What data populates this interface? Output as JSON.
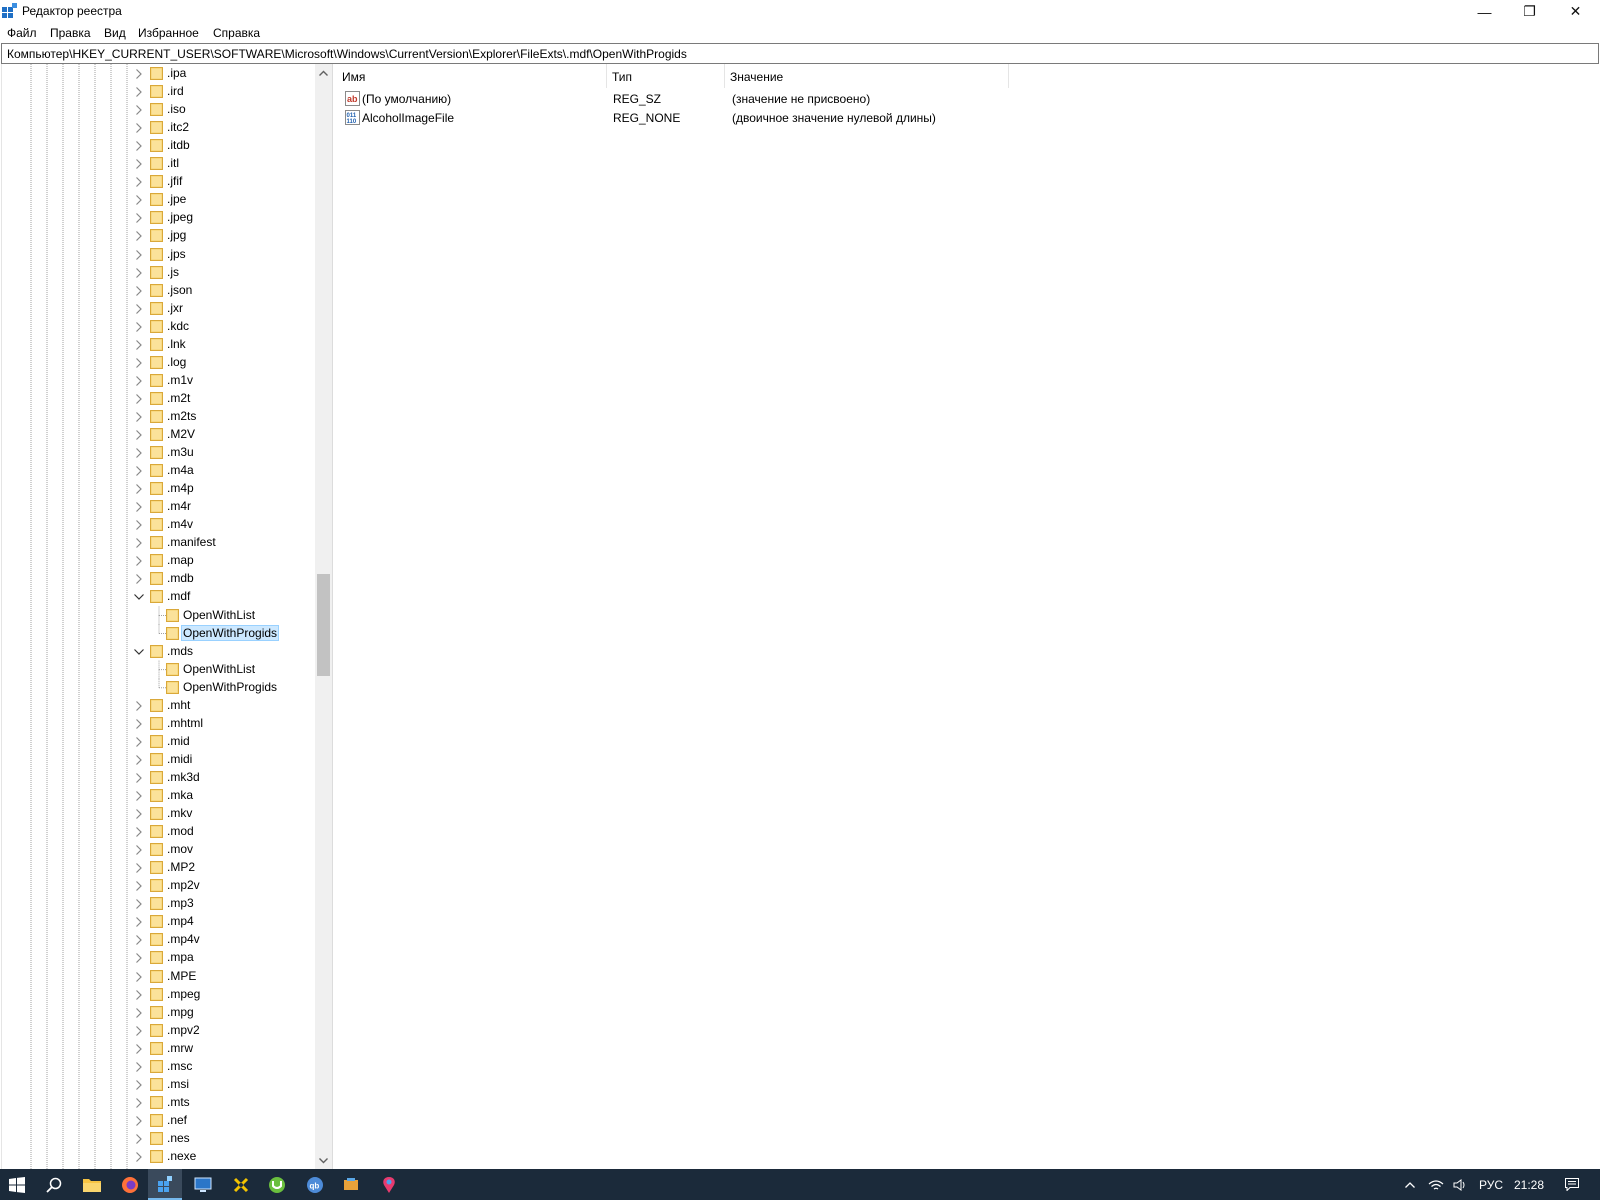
{
  "window": {
    "title": "Редактор реестра",
    "minimize": "—",
    "maximize": "❐",
    "close": "✕"
  },
  "menu": [
    "Файл",
    "Правка",
    "Вид",
    "Избранное",
    "Справка"
  ],
  "address": "Компьютер\\HKEY_CURRENT_USER\\SOFTWARE\\Microsoft\\Windows\\CurrentVersion\\Explorer\\FileExts\\.mdf\\OpenWithProgids",
  "tree": [
    {
      "label": ".ipa",
      "level": 0,
      "state": "collapsed"
    },
    {
      "label": ".ird",
      "level": 0,
      "state": "collapsed"
    },
    {
      "label": ".iso",
      "level": 0,
      "state": "collapsed"
    },
    {
      "label": ".itc2",
      "level": 0,
      "state": "collapsed"
    },
    {
      "label": ".itdb",
      "level": 0,
      "state": "collapsed"
    },
    {
      "label": ".itl",
      "level": 0,
      "state": "collapsed"
    },
    {
      "label": ".jfif",
      "level": 0,
      "state": "collapsed"
    },
    {
      "label": ".jpe",
      "level": 0,
      "state": "collapsed"
    },
    {
      "label": ".jpeg",
      "level": 0,
      "state": "collapsed"
    },
    {
      "label": ".jpg",
      "level": 0,
      "state": "collapsed"
    },
    {
      "label": ".jps",
      "level": 0,
      "state": "collapsed"
    },
    {
      "label": ".js",
      "level": 0,
      "state": "collapsed"
    },
    {
      "label": ".json",
      "level": 0,
      "state": "collapsed"
    },
    {
      "label": ".jxr",
      "level": 0,
      "state": "collapsed"
    },
    {
      "label": ".kdc",
      "level": 0,
      "state": "collapsed"
    },
    {
      "label": ".lnk",
      "level": 0,
      "state": "collapsed"
    },
    {
      "label": ".log",
      "level": 0,
      "state": "collapsed"
    },
    {
      "label": ".m1v",
      "level": 0,
      "state": "collapsed"
    },
    {
      "label": ".m2t",
      "level": 0,
      "state": "collapsed"
    },
    {
      "label": ".m2ts",
      "level": 0,
      "state": "collapsed"
    },
    {
      "label": ".M2V",
      "level": 0,
      "state": "collapsed"
    },
    {
      "label": ".m3u",
      "level": 0,
      "state": "collapsed"
    },
    {
      "label": ".m4a",
      "level": 0,
      "state": "collapsed"
    },
    {
      "label": ".m4p",
      "level": 0,
      "state": "collapsed"
    },
    {
      "label": ".m4r",
      "level": 0,
      "state": "collapsed"
    },
    {
      "label": ".m4v",
      "level": 0,
      "state": "collapsed"
    },
    {
      "label": ".manifest",
      "level": 0,
      "state": "collapsed"
    },
    {
      "label": ".map",
      "level": 0,
      "state": "collapsed"
    },
    {
      "label": ".mdb",
      "level": 0,
      "state": "collapsed"
    },
    {
      "label": ".mdf",
      "level": 0,
      "state": "expanded"
    },
    {
      "label": "OpenWithList",
      "level": 1,
      "state": "leaf"
    },
    {
      "label": "OpenWithProgids",
      "level": 1,
      "state": "leaf",
      "selected": true
    },
    {
      "label": ".mds",
      "level": 0,
      "state": "expanded"
    },
    {
      "label": "OpenWithList",
      "level": 1,
      "state": "leaf"
    },
    {
      "label": "OpenWithProgids",
      "level": 1,
      "state": "leaf"
    },
    {
      "label": ".mht",
      "level": 0,
      "state": "collapsed"
    },
    {
      "label": ".mhtml",
      "level": 0,
      "state": "collapsed"
    },
    {
      "label": ".mid",
      "level": 0,
      "state": "collapsed"
    },
    {
      "label": ".midi",
      "level": 0,
      "state": "collapsed"
    },
    {
      "label": ".mk3d",
      "level": 0,
      "state": "collapsed"
    },
    {
      "label": ".mka",
      "level": 0,
      "state": "collapsed"
    },
    {
      "label": ".mkv",
      "level": 0,
      "state": "collapsed"
    },
    {
      "label": ".mod",
      "level": 0,
      "state": "collapsed"
    },
    {
      "label": ".mov",
      "level": 0,
      "state": "collapsed"
    },
    {
      "label": ".MP2",
      "level": 0,
      "state": "collapsed"
    },
    {
      "label": ".mp2v",
      "level": 0,
      "state": "collapsed"
    },
    {
      "label": ".mp3",
      "level": 0,
      "state": "collapsed"
    },
    {
      "label": ".mp4",
      "level": 0,
      "state": "collapsed"
    },
    {
      "label": ".mp4v",
      "level": 0,
      "state": "collapsed"
    },
    {
      "label": ".mpa",
      "level": 0,
      "state": "collapsed"
    },
    {
      "label": ".MPE",
      "level": 0,
      "state": "collapsed"
    },
    {
      "label": ".mpeg",
      "level": 0,
      "state": "collapsed"
    },
    {
      "label": ".mpg",
      "level": 0,
      "state": "collapsed"
    },
    {
      "label": ".mpv2",
      "level": 0,
      "state": "collapsed"
    },
    {
      "label": ".mrw",
      "level": 0,
      "state": "collapsed"
    },
    {
      "label": ".msc",
      "level": 0,
      "state": "collapsed"
    },
    {
      "label": ".msi",
      "level": 0,
      "state": "collapsed"
    },
    {
      "label": ".mts",
      "level": 0,
      "state": "collapsed"
    },
    {
      "label": ".nef",
      "level": 0,
      "state": "collapsed"
    },
    {
      "label": ".nes",
      "level": 0,
      "state": "collapsed"
    },
    {
      "label": ".nexe",
      "level": 0,
      "state": "collapsed"
    }
  ],
  "values": {
    "columns": {
      "name": "Имя",
      "type": "Тип",
      "data": "Значение"
    },
    "rows": [
      {
        "icon": "string-value-icon",
        "name": "(По умолчанию)",
        "type": "REG_SZ",
        "data": "(значение не присвоено)"
      },
      {
        "icon": "binary-value-icon",
        "name": "AlcoholImageFile",
        "type": "REG_NONE",
        "data": "(двоичное значение нулевой длины)"
      }
    ]
  },
  "taskbar": {
    "apps": [
      "start-icon",
      "search-icon",
      "file-explorer-icon",
      "firefox-icon",
      "regedit-icon",
      "remote-desktop-icon",
      "xbox-icon",
      "utorrent-icon",
      "qbittorrent-icon",
      "network-app-icon",
      "paint-icon"
    ],
    "language": "РУС",
    "time": "21:28"
  },
  "colors": {
    "selection": "#cce8ff",
    "folder": "#f6d16c",
    "taskbar": "#1b2a3a"
  }
}
